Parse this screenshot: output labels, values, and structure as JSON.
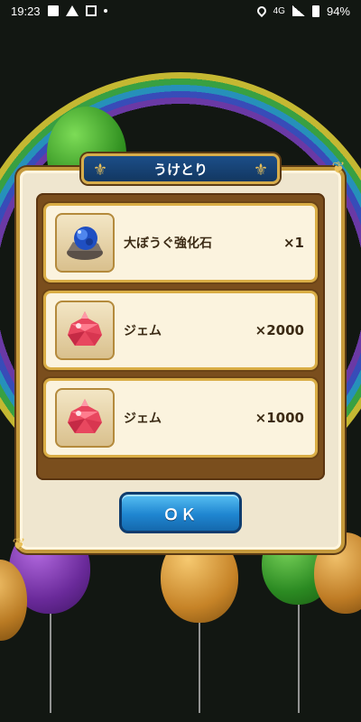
{
  "statusbar": {
    "time": "19:23",
    "network": "4G",
    "battery": "94%"
  },
  "dialog": {
    "title": "うけとり",
    "items": [
      {
        "name": "大ぼうぐ強化石",
        "quantity": "×1",
        "icon": "blue-ore-stone-icon"
      },
      {
        "name": "ジェム",
        "quantity": "×2000",
        "icon": "red-gem-icon"
      },
      {
        "name": "ジェム",
        "quantity": "×1000",
        "icon": "red-gem-icon"
      }
    ],
    "ok_label": "ＯＫ"
  },
  "colors": {
    "title_plate": "#1c4e88",
    "frame_gold": "#d9ad45",
    "ok_button": "#1f86d1",
    "panel_bg": "#efe6cf"
  }
}
